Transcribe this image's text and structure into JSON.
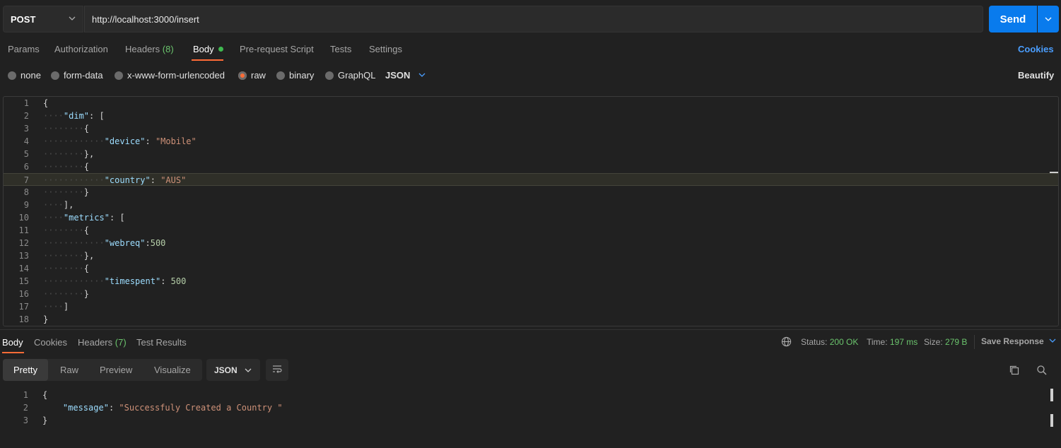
{
  "request": {
    "method": "POST",
    "url": "http://localhost:3000/insert",
    "send_label": "Send"
  },
  "tabs": [
    {
      "label": "Params"
    },
    {
      "label": "Authorization"
    },
    {
      "label": "Headers",
      "count": "(8)"
    },
    {
      "label": "Body"
    },
    {
      "label": "Pre-request Script"
    },
    {
      "label": "Tests"
    },
    {
      "label": "Settings"
    }
  ],
  "cookies_label": "Cookies",
  "body_types": [
    "none",
    "form-data",
    "x-www-form-urlencoded",
    "raw",
    "binary",
    "GraphQL"
  ],
  "body_type_selected": "raw",
  "format_label": "JSON",
  "beautify_label": "Beautify",
  "editor": {
    "lines": [
      {
        "n": "1",
        "tokens": [
          [
            "punc",
            "{"
          ]
        ]
      },
      {
        "n": "2",
        "tokens": [
          [
            "dots",
            "····"
          ],
          [
            "key",
            "\"dim\""
          ],
          [
            "punc",
            ": ["
          ]
        ]
      },
      {
        "n": "3",
        "tokens": [
          [
            "dots",
            "········"
          ],
          [
            "punc",
            "{"
          ]
        ]
      },
      {
        "n": "4",
        "tokens": [
          [
            "dots",
            "············"
          ],
          [
            "key",
            "\"device\""
          ],
          [
            "punc",
            ": "
          ],
          [
            "str",
            "\"Mobile\""
          ]
        ]
      },
      {
        "n": "5",
        "tokens": [
          [
            "dots",
            "········"
          ],
          [
            "punc",
            "},"
          ]
        ]
      },
      {
        "n": "6",
        "tokens": [
          [
            "dots",
            "········"
          ],
          [
            "punc",
            "{"
          ]
        ]
      },
      {
        "n": "7",
        "tokens": [
          [
            "dots",
            "············"
          ],
          [
            "key",
            "\"country\""
          ],
          [
            "punc",
            ": "
          ],
          [
            "str",
            "\"AUS\""
          ]
        ]
      },
      {
        "n": "8",
        "tokens": [
          [
            "dots",
            "········"
          ],
          [
            "punc",
            "}"
          ]
        ]
      },
      {
        "n": "9",
        "tokens": [
          [
            "dots",
            "····"
          ],
          [
            "punc",
            "],"
          ]
        ]
      },
      {
        "n": "10",
        "tokens": [
          [
            "dots",
            "····"
          ],
          [
            "key",
            "\"metrics\""
          ],
          [
            "punc",
            ": ["
          ]
        ]
      },
      {
        "n": "11",
        "tokens": [
          [
            "dots",
            "········"
          ],
          [
            "punc",
            "{"
          ]
        ]
      },
      {
        "n": "12",
        "tokens": [
          [
            "dots",
            "············"
          ],
          [
            "key",
            "\"webreq\""
          ],
          [
            "punc",
            ":"
          ],
          [
            "num",
            "500"
          ]
        ]
      },
      {
        "n": "13",
        "tokens": [
          [
            "dots",
            "········"
          ],
          [
            "punc",
            "},"
          ]
        ]
      },
      {
        "n": "14",
        "tokens": [
          [
            "dots",
            "········"
          ],
          [
            "punc",
            "{"
          ]
        ]
      },
      {
        "n": "15",
        "tokens": [
          [
            "dots",
            "············"
          ],
          [
            "key",
            "\"timespent\""
          ],
          [
            "punc",
            ": "
          ],
          [
            "num",
            "500"
          ]
        ]
      },
      {
        "n": "16",
        "tokens": [
          [
            "dots",
            "········"
          ],
          [
            "punc",
            "}"
          ]
        ]
      },
      {
        "n": "17",
        "tokens": [
          [
            "dots",
            "····"
          ],
          [
            "punc",
            "]"
          ]
        ]
      },
      {
        "n": "18",
        "tokens": [
          [
            "punc",
            "}"
          ]
        ]
      }
    ],
    "highlighted_line": "7"
  },
  "response": {
    "tabs": [
      {
        "label": "Body"
      },
      {
        "label": "Cookies"
      },
      {
        "label": "Headers",
        "count": "(7)"
      },
      {
        "label": "Test Results"
      }
    ],
    "status_label": "Status:",
    "status_value": "200 OK",
    "time_label": "Time:",
    "time_value": "197 ms",
    "size_label": "Size:",
    "size_value": "279 B",
    "save_label": "Save Response",
    "views": [
      "Pretty",
      "Raw",
      "Preview",
      "Visualize"
    ],
    "view_selected": "Pretty",
    "format_label": "JSON",
    "lines": [
      {
        "n": "1",
        "tokens": [
          [
            "punc",
            "{"
          ]
        ]
      },
      {
        "n": "2",
        "tokens": [
          [
            "dots",
            "    "
          ],
          [
            "key",
            "\"message\""
          ],
          [
            "punc",
            ": "
          ],
          [
            "str",
            "\"Successfuly Created a Country \""
          ]
        ]
      },
      {
        "n": "3",
        "tokens": [
          [
            "punc",
            "}"
          ]
        ]
      }
    ]
  },
  "colors": {
    "accent": "#ff6c37",
    "send": "#097bed",
    "link": "#4a9eff",
    "success": "#6bc46d"
  }
}
